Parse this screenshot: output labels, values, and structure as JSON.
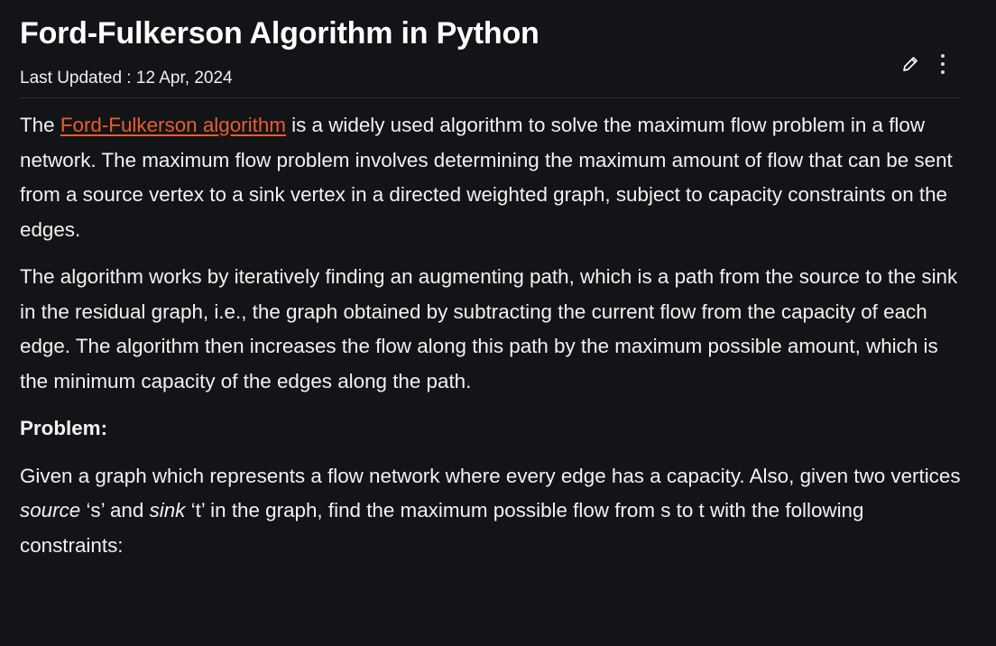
{
  "article": {
    "title": "Ford-Fulkerson Algorithm in Python",
    "last_updated_label": "Last Updated : ",
    "last_updated_date": "12 Apr, 2024"
  },
  "actions": {
    "edit_icon": "pencil-icon",
    "more_icon": "kebab-menu-icon"
  },
  "paragraph1": {
    "prefix": "The ",
    "link_text": "Ford-Fulkerson algorithm",
    "suffix": " is a widely used algorithm to solve the maximum flow problem in a flow network. The maximum flow problem involves determining the maximum amount of flow that can be sent from a source vertex to a sink vertex in a directed weighted graph, subject to capacity constraints on the edges."
  },
  "paragraph2": {
    "text": "The algorithm works by iteratively finding an augmenting path, which is a path from the source to the sink in the residual graph, i.e., the graph obtained by subtracting the current flow from the capacity of each edge. The algorithm then increases the flow along this path by the maximum possible amount, which is the minimum capacity of the edges along the path."
  },
  "problem": {
    "heading": "Problem:",
    "part1": "Given a graph which represents a flow network where every edge has a capacity. Also, given two vertices ",
    "source_word": "source",
    "part2": " ‘s’ and ",
    "sink_word": "sink",
    "part3": " ‘t’ in the graph, find the maximum possible flow from s to t with the following constraints:"
  },
  "colors": {
    "background": "#131417",
    "link": "#e85d2e",
    "text": "#f2f2f2"
  }
}
